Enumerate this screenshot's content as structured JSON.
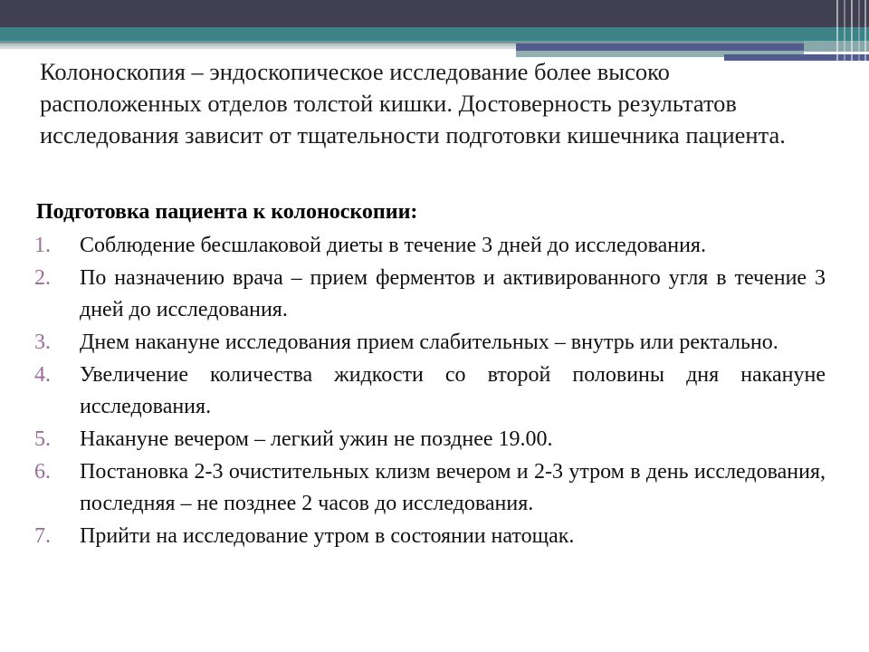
{
  "slide": {
    "heading": "Колоноскопия – эндоскопическое исследование более высоко расположенных отделов толстой кишки. Достоверность результатов исследования зависит от тщательности подготовки кишечника пациента.",
    "subtitle": "Подготовка пациента к колоноскопии:",
    "list": [
      {
        "number": "1.",
        "text": "Соблюдение бесшлаковой диеты в течение 3 дней до исследования.",
        "single_line": false
      },
      {
        "number": "2.",
        "text": "По назначению врача – прием ферментов и активированного угля в течение 3 дней до исследования.",
        "single_line": false
      },
      {
        "number": "3.",
        "text": "Днем накануне исследования прием слабительных – внутрь или ректально.",
        "single_line": false
      },
      {
        "number": "4.",
        "text": "Увеличение количества жидкости со второй половины дня накануне исследования.",
        "single_line": false
      },
      {
        "number": "5.",
        "text": "Накануне вечером – легкий ужин не позднее 19.00.",
        "single_line": true
      },
      {
        "number": "6.",
        "text": "Постановка 2-3 очистительных клизм вечером и 2-3 утром в день исследования, последняя – не позднее 2 часов до исследования.",
        "single_line": false
      },
      {
        "number": "7.",
        "text": "Прийти на исследование утром в состоянии натощак.",
        "single_line": true
      }
    ]
  },
  "theme": {
    "navy": "#414052",
    "teal": "#3d8286",
    "slate_purple": "#515b8c",
    "number_mauve": "#9b6b9e",
    "grey_light": "#b9c4c5",
    "background": "#ffffff",
    "body_text": "#111111"
  }
}
